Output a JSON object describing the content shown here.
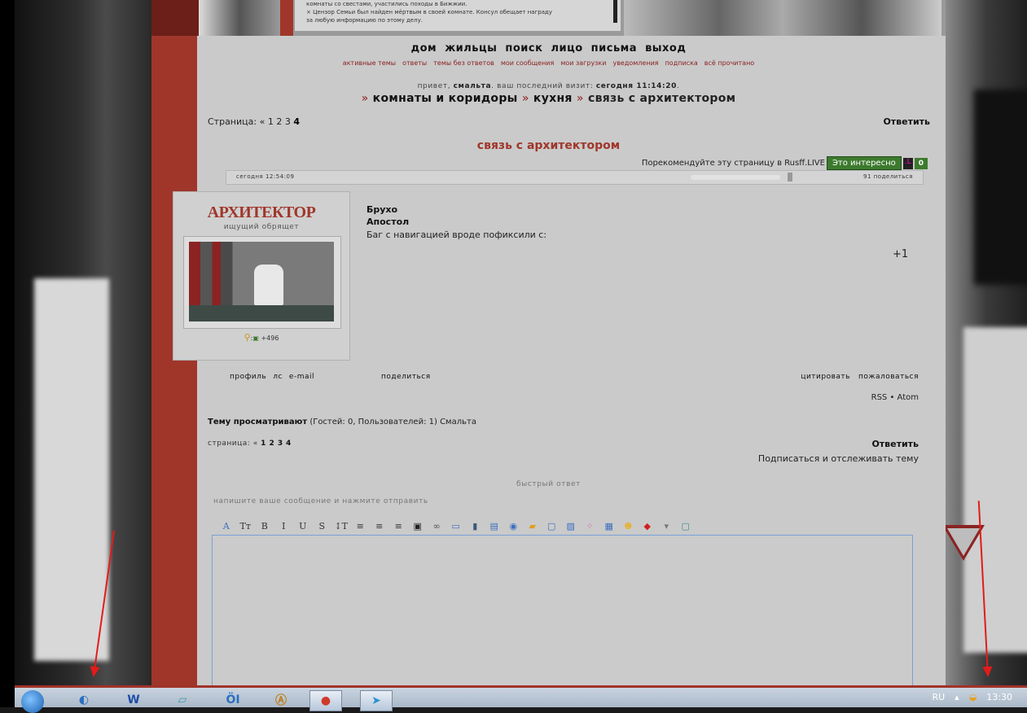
{
  "banner": {
    "line1": "комнаты со свестами, участились походы в Бижжии.",
    "line2": "× Цензор Семьи был найден мёртвым в своей комнате. Консул обещает награду",
    "line3": "за любую информацию по этому делу."
  },
  "nav": {
    "items": [
      "дом",
      "жильцы",
      "поиск",
      "лицо",
      "письма",
      "выход"
    ],
    "sub": [
      "активные темы",
      "ответы",
      "темы без ответов",
      "мои сообщения",
      "мои загрузки",
      "уведомления",
      "подписка",
      "всё прочитано"
    ]
  },
  "greeting": {
    "prefix": "привет,",
    "user": "смальта",
    "mid": ". ваш последний визит:",
    "visit": "сегодня 11:14:20",
    "end": "."
  },
  "breadcrumb": {
    "sep": "»",
    "items": [
      "комнаты и коридоры",
      "кухня",
      "связь с архитектором"
    ]
  },
  "pager": {
    "label": "Страница:",
    "prev": "«",
    "pages": [
      "1",
      "2",
      "3"
    ],
    "current": "4"
  },
  "reply_label": "Ответить",
  "topic_title": "связь с архитектором",
  "recommend": {
    "text": "Порекомендуйте эту страницу в Rusff.LIVE",
    "button": "Это интересно",
    "logo": ".L",
    "count": "0"
  },
  "post": {
    "time": "сегодня 12:54:09",
    "number": "91",
    "share": "поделиться",
    "avatar_title": "АРХИТЕКТОР",
    "avatar_subtitle": "ищущий обрящет",
    "stats_sep": ":",
    "stats_value": "+496",
    "author": "Брухо",
    "rank": "Апостол",
    "message": "Баг с навигацией вроде пофиксили с:",
    "rating": "+1",
    "links_left": [
      "профиль",
      "лс",
      "e-mail"
    ],
    "links_share": "поделиться",
    "links_right": [
      "цитировать",
      "пожаловаться"
    ]
  },
  "feeds": "RSS • Atom",
  "viewers": {
    "label": "Тему просматривают",
    "detail": "(Гостей: 0, Пользователей: 1)",
    "user": "Смальта"
  },
  "pager2": {
    "label": "страница:",
    "prev": "«",
    "pages": "1 2 3",
    "current": "4"
  },
  "subscribe": "Подписаться и отслеживать тему",
  "quick_reply": {
    "title": "быстрый ответ",
    "hint": "напишите ваше сообщение и нажмите отправить"
  },
  "toolbar": [
    {
      "icon": "font-icon",
      "glyph": "A",
      "color": "#3a6fc0"
    },
    {
      "icon": "font-size-icon",
      "glyph": "Tт",
      "color": "#333"
    },
    {
      "icon": "bold-icon",
      "glyph": "B",
      "color": "#333"
    },
    {
      "icon": "italic-icon",
      "glyph": "I",
      "color": "#333"
    },
    {
      "icon": "underline-icon",
      "glyph": "U",
      "color": "#333"
    },
    {
      "icon": "strikethrough-icon",
      "glyph": "S",
      "color": "#333"
    },
    {
      "icon": "line-height-icon",
      "glyph": "↕T",
      "color": "#333"
    },
    {
      "icon": "align-left-icon",
      "glyph": "≡",
      "color": "#333"
    },
    {
      "icon": "align-center-icon",
      "glyph": "≡",
      "color": "#333"
    },
    {
      "icon": "align-right-icon",
      "glyph": "≡",
      "color": "#333"
    },
    {
      "icon": "image-icon",
      "glyph": "▣",
      "color": "#222"
    },
    {
      "icon": "link-icon",
      "glyph": "∞",
      "color": "#555"
    },
    {
      "icon": "book-icon",
      "glyph": "▭",
      "color": "#3a6fc0"
    },
    {
      "icon": "bookmark-icon",
      "glyph": "▮",
      "color": "#3a5a7a"
    },
    {
      "icon": "copy-icon",
      "glyph": "▤",
      "color": "#3a6fc0"
    },
    {
      "icon": "play-icon",
      "glyph": "◉",
      "color": "#3a6fc0"
    },
    {
      "icon": "lock-icon",
      "glyph": "▰",
      "color": "#e0a020"
    },
    {
      "icon": "speech-icon",
      "glyph": "▢",
      "color": "#3a6fc0"
    },
    {
      "icon": "quote-icon",
      "glyph": "▨",
      "color": "#3a6fc0"
    },
    {
      "icon": "palette-icon",
      "glyph": "⁘",
      "color": "#d050a0"
    },
    {
      "icon": "table-icon",
      "glyph": "▦",
      "color": "#3a6fc0"
    },
    {
      "icon": "smiley-icon",
      "glyph": "☻",
      "color": "#e8b020"
    },
    {
      "icon": "dice-icon",
      "glyph": "◆",
      "color": "#d02020"
    },
    {
      "icon": "more-icon",
      "glyph": "▾",
      "color": "#777"
    },
    {
      "icon": "clear-icon",
      "glyph": "▢",
      "color": "#3a8a8a"
    }
  ],
  "taskbar": {
    "lang": "RU",
    "tray_arrow": "▴",
    "clock": "13:30",
    "apps": [
      {
        "name": "fileman-app",
        "glyph": "◐",
        "color": "#2a6fc0"
      },
      {
        "name": "word-app",
        "glyph": "W",
        "color": "#1f4fa8"
      },
      {
        "name": "notes-app",
        "glyph": "▱",
        "color": "#3a9ab0"
      },
      {
        "name": "game-app",
        "glyph": "ÖI",
        "color": "#2a6fc0"
      },
      {
        "name": "aimp-app",
        "glyph": "Ⓐ",
        "color": "#c07a10"
      },
      {
        "name": "chrome-app",
        "glyph": "●",
        "color": "#d03a2a"
      },
      {
        "name": "telegram-app",
        "glyph": "➤",
        "color": "#2a90d0"
      }
    ]
  }
}
